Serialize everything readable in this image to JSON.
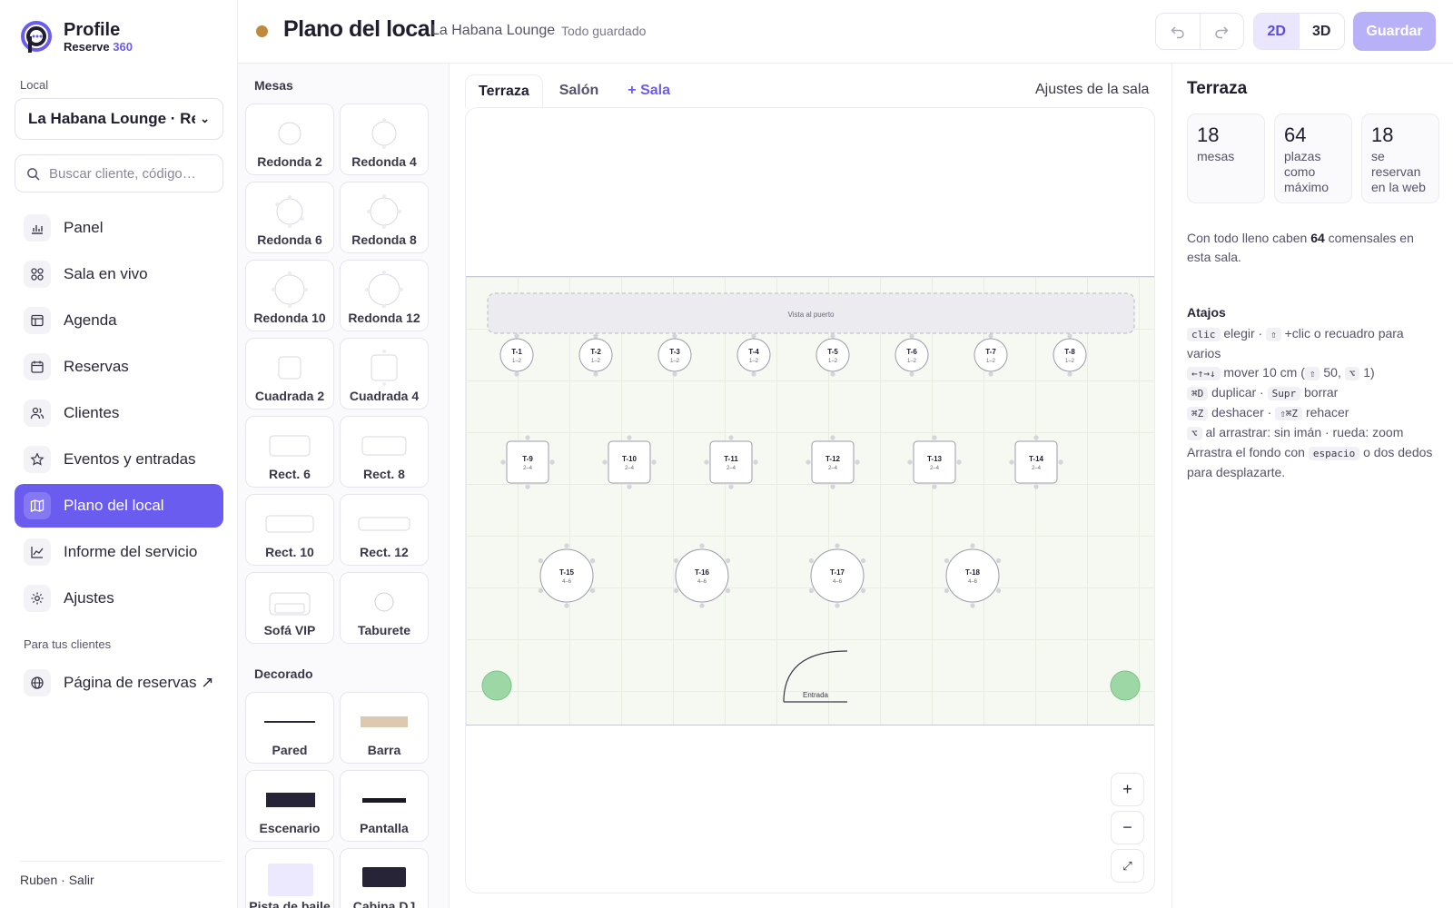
{
  "brand": {
    "name": "Profile",
    "sub": "Reserve",
    "sub_accent": "360",
    "accent": "#6b5cf0"
  },
  "sidebar": {
    "local_label": "Local",
    "local_value": "La Habana Lounge · Restaurante",
    "search_placeholder": "Buscar cliente, código…",
    "nav": [
      {
        "label": "Panel",
        "icon": "bar-chart-icon"
      },
      {
        "label": "Sala en vivo",
        "icon": "grid-icon"
      },
      {
        "label": "Agenda",
        "icon": "table-icon"
      },
      {
        "label": "Reservas",
        "icon": "calendar-icon"
      },
      {
        "label": "Clientes",
        "icon": "users-icon"
      },
      {
        "label": "Eventos y entradas",
        "icon": "star-icon"
      },
      {
        "label": "Plano del local",
        "icon": "map-icon",
        "active": true
      },
      {
        "label": "Informe del servicio",
        "icon": "line-chart-icon"
      },
      {
        "label": "Ajustes",
        "icon": "gear-icon"
      }
    ],
    "clients_label": "Para tus clientes",
    "booking_page": "Página de reservas ↗",
    "footer": "Ruben · Salir"
  },
  "topbar": {
    "title": "Plano del local",
    "venue": "La Habana Lounge",
    "status": "Todo guardado",
    "view_2d": "2D",
    "view_3d": "3D",
    "save": "Guardar"
  },
  "palette": {
    "tables_heading": "Mesas",
    "tables": [
      "Redonda 2",
      "Redonda 4",
      "Redonda 6",
      "Redonda 8",
      "Redonda 10",
      "Redonda 12",
      "Cuadrada 2",
      "Cuadrada 4",
      "Rect. 6",
      "Rect. 8",
      "Rect. 10",
      "Rect. 12",
      "Sofá VIP",
      "Taburete"
    ],
    "decor_heading": "Decorado",
    "decor": [
      "Pared",
      "Barra",
      "Escenario",
      "Pantalla",
      "Pista de baile",
      "Cabina DJ"
    ]
  },
  "canvas": {
    "tabs": [
      "Terraza",
      "Salón",
      "+ Sala"
    ],
    "room_settings": "Ajustes de la sala",
    "view_label": "Vista al puerto",
    "entrance_label": "Entrada",
    "zoom_in": "+",
    "zoom_out": "−",
    "fit": "⤢",
    "row1": [
      {
        "id": "T-1",
        "cap": "1–2"
      },
      {
        "id": "T-2",
        "cap": "1–2"
      },
      {
        "id": "T-3",
        "cap": "1–2"
      },
      {
        "id": "T-4",
        "cap": "1–2"
      },
      {
        "id": "T-5",
        "cap": "1–2"
      },
      {
        "id": "T-6",
        "cap": "1–2"
      },
      {
        "id": "T-7",
        "cap": "1–2"
      },
      {
        "id": "T-8",
        "cap": "1–2"
      }
    ],
    "row2": [
      {
        "id": "T-9",
        "cap": "2–4"
      },
      {
        "id": "T-10",
        "cap": "2–4"
      },
      {
        "id": "T-11",
        "cap": "2–4"
      },
      {
        "id": "T-12",
        "cap": "2–4"
      },
      {
        "id": "T-13",
        "cap": "2–4"
      },
      {
        "id": "T-14",
        "cap": "2–4"
      }
    ],
    "row3": [
      {
        "id": "T-15",
        "cap": "4–6"
      },
      {
        "id": "T-16",
        "cap": "4–6"
      },
      {
        "id": "T-17",
        "cap": "4–6"
      },
      {
        "id": "T-18",
        "cap": "4–6"
      }
    ]
  },
  "panel": {
    "title": "Terraza",
    "stats": [
      {
        "n": "18",
        "t": "mesas"
      },
      {
        "n": "64",
        "t": "plazas como máximo"
      },
      {
        "n": "18",
        "t": "se reservan en la web"
      }
    ],
    "cap_pre": "Con todo lleno caben ",
    "cap_num": "64",
    "cap_post": " comensales en esta sala.",
    "shortcuts_heading": "Atajos",
    "sc": {
      "k1": "clic",
      "t1": " elegir · ",
      "k2": "⇧",
      "t2": " +clic o recuadro para varios",
      "k3": "←↑→↓",
      "t3": " mover 10 cm (",
      "k4": "⇧",
      "t4": " 50, ",
      "k5": "⌥",
      "t5": " 1)",
      "k6": "⌘D",
      "t6": " duplicar · ",
      "k7": "Supr",
      "t7": " borrar",
      "k8": "⌘Z",
      "t8": " deshacer · ",
      "k9": "⇧⌘Z",
      "t9": " rehacer",
      "k10": "⌥",
      "t10": " al arrastrar: sin imán · rueda: zoom",
      "t11": "Arrastra el fondo con ",
      "k11": "espacio",
      "t12": " o dos dedos para desplazarte."
    }
  }
}
